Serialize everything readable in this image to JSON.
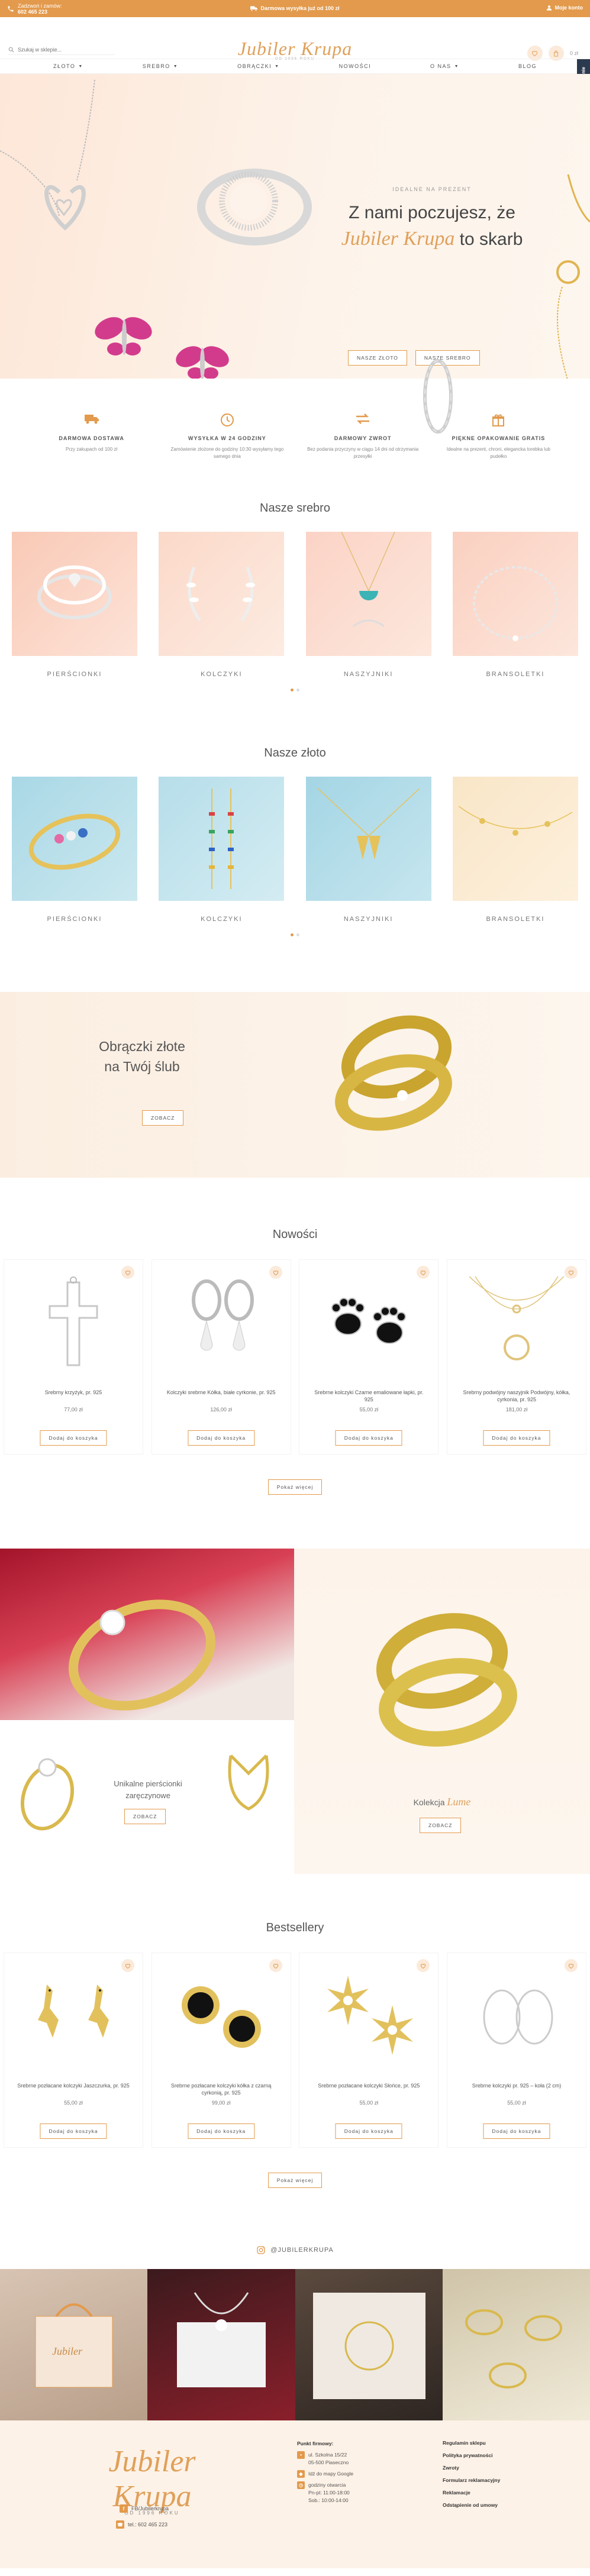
{
  "topbar": {
    "phone_label": "Zadzwoń i zamów:",
    "phone_number": "602 465 223",
    "shipping": "Darmowa wysyłka już od 100 zł",
    "help": "Moje konto"
  },
  "header": {
    "search_placeholder": "Szukaj w sklepie...",
    "logo_text": "Jubiler Krupa",
    "logo_sub": "OD 1996 ROKU",
    "cart_total": "0 zł"
  },
  "nav": {
    "items": [
      {
        "label": "ZŁOTO",
        "dropdown": true
      },
      {
        "label": "SREBRO",
        "dropdown": true
      },
      {
        "label": "OBRĄCZKI",
        "dropdown": true
      },
      {
        "label": "NOWOŚCI",
        "dropdown": false
      },
      {
        "label": "O NAS",
        "dropdown": true
      },
      {
        "label": "BLOG",
        "dropdown": false
      }
    ]
  },
  "side_tab": "Sprawdź Opinie",
  "hero": {
    "eyebrow": "IDEALNE NA PREZENT",
    "line1": "Z nami poczujesz, że",
    "brand": "Jubiler Krupa",
    "line2_suffix": "to skarb",
    "btn_gold": "NASZE ZŁOTO",
    "btn_silver": "NASZE SREBRO"
  },
  "features": [
    {
      "icon": "truck-icon",
      "title": "DARMOWA DOSTAWA",
      "desc": "Przy zakupach od 100 zł"
    },
    {
      "icon": "clock-icon",
      "title": "WYSYŁKA W 24 GODZINY",
      "desc": "Zamówienie złożone do godziny 10:30 wysyłamy tego samego dnia"
    },
    {
      "icon": "exchange-icon",
      "title": "DARMOWY ZWROT",
      "desc": "Bez podania przyczyny w ciągu 14 dni od otrzymania przesyłki"
    },
    {
      "icon": "gift-icon",
      "title": "PIĘKNE OPAKOWANIE GRATIS",
      "desc": "Idealne na prezent, chroni, elegancka torebka lub pudełko"
    }
  ],
  "silver": {
    "title": "Nasze srebro",
    "cats": [
      "PIERŚCIONKI",
      "KOLCZYKI",
      "NASZYJNIKI",
      "BRANSOLETKI"
    ]
  },
  "gold": {
    "title": "Nasze złoto",
    "cats": [
      "PIERŚCIONKI",
      "KOLCZYKI",
      "NASZYJNIKI",
      "BRANSOLETKI"
    ]
  },
  "wedding": {
    "line1": "Obrączki złote",
    "line2": "na Twój ślub",
    "btn": "ZOBACZ"
  },
  "news": {
    "title": "Nowości",
    "products": [
      {
        "name": "Srebrny krzyżyk, pr. 925",
        "price": "77,00 zł"
      },
      {
        "name": "Kolczyki srebrne Kółka, białe cyrkonie, pr. 925",
        "price": "126,00 zł"
      },
      {
        "name": "Srebrne kolczyki Czarne emaliowane łapki, pr. 925",
        "price": "55,00 zł"
      },
      {
        "name": "Srebrny podwójny naszyjnik Podwójny, kółka, cyrkonia, pr. 925",
        "price": "181,00 zł"
      }
    ],
    "add_label": "Dodaj do koszyka",
    "more": "Pokaż więcej"
  },
  "split": {
    "left_text1": "Unikalne pierścionki",
    "left_text2": "zaręczynowe",
    "left_btn": "ZOBACZ",
    "right_text": "Kolekcja",
    "right_brand": "Lume",
    "right_btn": "ZOBACZ"
  },
  "best": {
    "title": "Bestsellery",
    "products": [
      {
        "name": "Srebrne pozłacane kolczyki Jaszczurka, pr. 925",
        "price": "55,00 zł"
      },
      {
        "name": "Srebrne pozłacane kolczyki kółka z czarną cyrkonią, pr. 925",
        "price": "99,00 zł"
      },
      {
        "name": "Srebrne pozłacane kolczyki Słońce, pr. 925",
        "price": "55,00 zł"
      },
      {
        "name": "Srebrne kolczyki pr. 925 – koła (2 cm)",
        "price": "55,00 zł"
      }
    ],
    "add_label": "Dodaj do koszyka",
    "more": "Pokaż więcej"
  },
  "instagram": {
    "handle": "@JUBILERKRUPA"
  },
  "footer": {
    "logo_text": "Jubiler Krupa",
    "logo_sub": "OD 1996 ROKU",
    "fb": "FB/Jubilerkrupa",
    "tel": "tel.: 602 465 223",
    "company_title": "Punkt firmowy:",
    "address1": "ul. Szkolna 15/22",
    "address2": "05-500 Piaseczno",
    "map": "Idź do mapy Google",
    "hours_title": "godziny otwarcia",
    "hours1": "Pn-pt: 11:00-18:00",
    "hours2": "Sob.: 10:00-14:00",
    "links": [
      "Regulamin sklepu",
      "Polityka prywatności",
      "Zwroty",
      "Formularz reklamacyjny",
      "Reklamacje",
      "Odstąpienie od umowy"
    ]
  },
  "colors": {
    "accent": "#e39a4c",
    "peach": "#fbeada",
    "dark": "#2c3a4f"
  }
}
